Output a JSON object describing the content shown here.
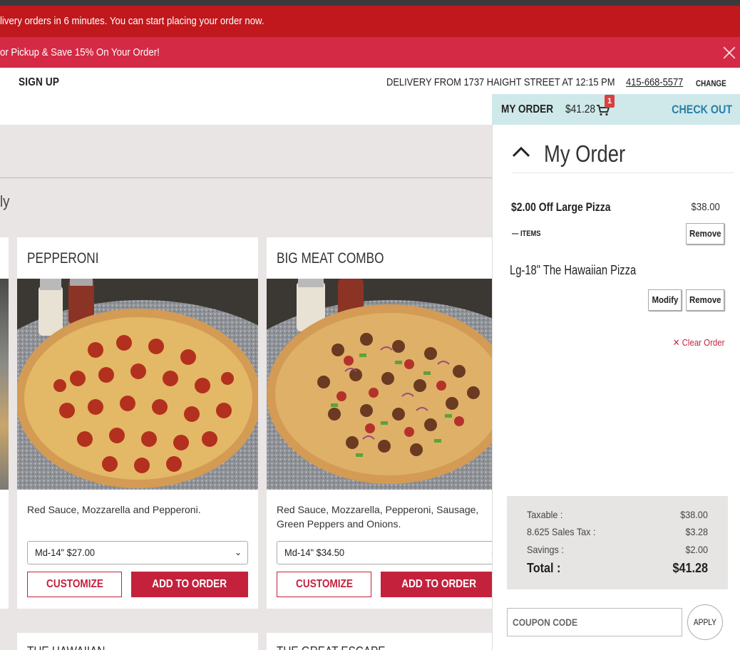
{
  "banners": {
    "top_message": "livery orders in 6 minutes. You can start placing your order now.",
    "promo_message": "or Pickup & Save 15% On Your Order!"
  },
  "header": {
    "sign_up": "SIGN UP",
    "delivery_text": "DELIVERY FROM 1737 HAIGHT STREET AT 12:15 PM",
    "phone": "415-668-5577",
    "change": "CHANGE"
  },
  "order_bar": {
    "label": "MY ORDER",
    "amount": "$41.28",
    "cart_count": "1",
    "checkout": "CHECK OUT"
  },
  "section": {
    "heading_fragment": "ly"
  },
  "cards": [
    {
      "title": "PEPPERONI",
      "description": "Red Sauce, Mozzarella and Pepperoni.",
      "selected_option": "Md-14\"  $27.00",
      "customize": "CUSTOMIZE",
      "add": "ADD TO ORDER"
    },
    {
      "title": "BIG MEAT COMBO",
      "description": "Red Sauce, Mozzarella, Pepperoni, Sausage, Green Peppers and Onions.",
      "selected_option": "Md-14\"  $34.50",
      "customize": "CUSTOMIZE",
      "add": "ADD TO ORDER"
    }
  ],
  "next_cards": [
    "THE HAWAIIAN",
    "THE GREAT ESCAPE"
  ],
  "panel": {
    "title": "My Order",
    "item_name": "$2.00 Off Large Pizza",
    "item_price": "$38.00",
    "items_toggle": "—  ITEMS",
    "remove": "Remove",
    "sub_item": "Lg-18\" The Hawaiian Pizza",
    "modify": "Modify",
    "clear_order": "✕ Clear Order",
    "totals": [
      {
        "label": "Taxable :",
        "value": "$38.00"
      },
      {
        "label": "8.625 Sales Tax :",
        "value": "$3.28"
      },
      {
        "label": "Savings :",
        "value": "$2.00"
      },
      {
        "label": "Total :",
        "value": "$41.28"
      }
    ],
    "coupon_placeholder": "COUPON CODE",
    "apply": "APPLY"
  },
  "colors": {
    "banner_red": "#c0181c",
    "promo_pink": "#d42a45",
    "brand_red": "#c4213d",
    "order_bar_bg": "#cfe9ea",
    "checkout_blue": "#2a7fa8"
  }
}
